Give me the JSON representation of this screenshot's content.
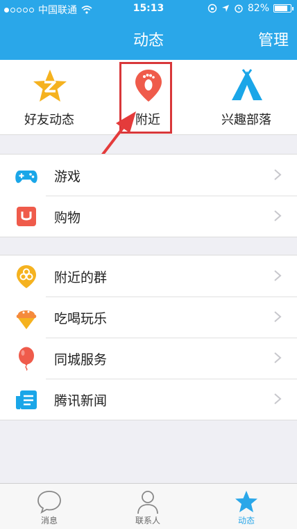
{
  "status_bar": {
    "carrier": "中国联通",
    "time": "15:13",
    "battery": "82%",
    "battery_level": 0.82
  },
  "header": {
    "title": "动态",
    "manage_label": "管理"
  },
  "top_items": [
    {
      "label": "好友动态",
      "icon": "star-z-icon"
    },
    {
      "label": "附近",
      "icon": "footprint-pin-icon"
    },
    {
      "label": "兴趣部落",
      "icon": "tent-icon"
    }
  ],
  "group1": [
    {
      "label": "游戏",
      "icon": "gamepad-icon"
    },
    {
      "label": "购物",
      "icon": "shopping-bag-icon"
    }
  ],
  "group2": [
    {
      "label": "附近的群",
      "icon": "group-pin-icon"
    },
    {
      "label": "吃喝玩乐",
      "icon": "ice-cream-icon"
    },
    {
      "label": "同城服务",
      "icon": "balloon-icon"
    },
    {
      "label": "腾讯新闻",
      "icon": "newspaper-icon"
    }
  ],
  "tabbar": [
    {
      "label": "消息",
      "icon": "chat-bubble-icon"
    },
    {
      "label": "联系人",
      "icon": "person-icon"
    },
    {
      "label": "动态",
      "icon": "star-icon",
      "active": true
    }
  ],
  "colors": {
    "accent": "#2aa7e9",
    "highlight": "#d8373a"
  }
}
